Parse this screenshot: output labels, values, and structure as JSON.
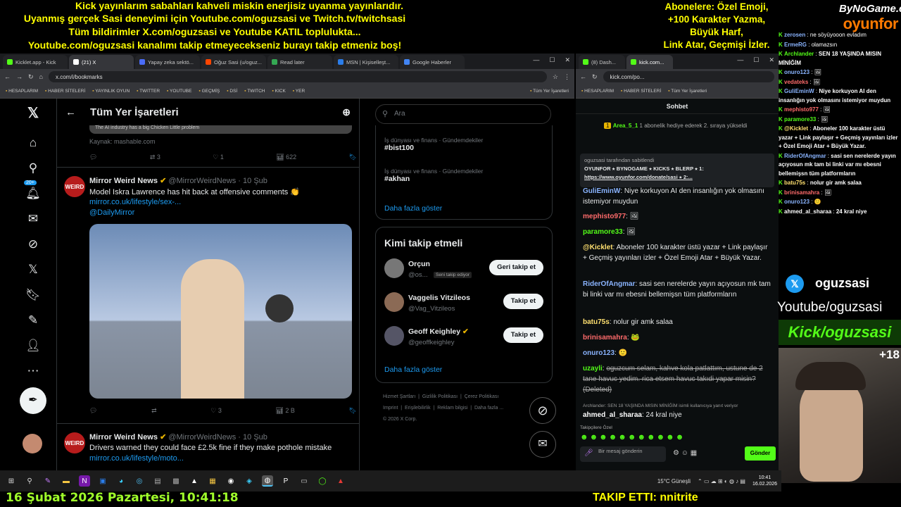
{
  "overlay": {
    "banner_left": [
      "Kick yayınlarım sabahları kahveli miskin enerjisiz uyanma yayınlarıdır.",
      "Uyanmış gerçek Sasi deneyimi için Youtube.com/oguzsasi ve Twitch.tv/twitchsasi",
      "Tüm bildirimler X.com/oguzsasi ve Youtube KATIL topluluktа...",
      "Youtube.com/oguzsasi kanalımı takip etmeyecekseniz burayı takip etmeniz boş!"
    ],
    "banner_right": [
      "Abonelere: Özel Emoji,",
      "+100 Karakter Yazma,",
      "Büyük Harf,",
      "Link Atar, Geçmişi İzler."
    ],
    "logo_top": "ByNoGame.com",
    "logo_bottom": "oyunfor",
    "social_handle": "oguzsasi",
    "youtube_text": "Youtube/oguzsasi",
    "kick_text": "Kick/oguzsasi",
    "age_badge": "+18",
    "datetime": "16 Şubat 2026 Pazartesi, 10:41:18",
    "followed_text": "TAKIP ETTI: nnitrite"
  },
  "browser_left": {
    "tabs": [
      {
        "label": "Kicklet.app - Kick",
        "color": "#53fc18"
      },
      {
        "label": "(21) X",
        "color": "#ffffff"
      },
      {
        "label": "Yapay zeka sektö...",
        "color": "#4a6cf7"
      },
      {
        "label": "Oğuz Sasi (u/oguz...",
        "color": "#ff4500"
      },
      {
        "label": "Read later",
        "color": "#34a853"
      },
      {
        "label": "MSN | Kişiselleşt...",
        "color": "#2b7de9"
      },
      {
        "label": "Google Haberler",
        "color": "#4285f4"
      }
    ],
    "url": "x.com/i/bookmarks",
    "bookmarks": [
      "HESAPLARIM",
      "HABER SİTELERİ",
      "YAYINLIK OYUN",
      "TWITTER",
      "YOUTUBE",
      "GEÇMİŞ",
      "DSİ",
      "TWITCH",
      "KICK",
      "YER",
      "Tüm Yer İşaretleri"
    ]
  },
  "x": {
    "header_title": "Tüm Yer İşaretleri",
    "notif_badge": "20+",
    "prev_tweet": {
      "caption": "The AI industry has a big Chicken Little problem",
      "source": "Kaynak: mashable.com",
      "retweets": "3",
      "likes": "1",
      "views": "622"
    },
    "tweets": [
      {
        "avatar": "WEIRD",
        "name": "Mirror Weird News",
        "handle": "@MirrorWeirdNews · 10 Şub",
        "text": "Model Iskra Lawrence has hit back at offensive comments 👏",
        "link": "mirror.co.uk/lifestyle/sex-...",
        "link2": "@DailyMirror",
        "likes": "3",
        "views": "2 B"
      },
      {
        "avatar": "WEIRD",
        "name": "Mirror Weird News",
        "handle": "@MirrorWeirdNews · 10 Şub",
        "text": "Drivers warned they could face £2.5k fine if they make pothole mistake",
        "link": "mirror.co.uk/lifestyle/moto..."
      }
    ],
    "search_placeholder": "Ara",
    "trends": [
      {
        "sub": "İş dünyası ve finans · Gündemdekiler",
        "title": "#bist100"
      },
      {
        "sub": "İş dünyası ve finans · Gündemdekiler",
        "title": "#akhan"
      }
    ],
    "show_more": "Daha fazla göster",
    "who_title": "Kimi takip etmeli",
    "who": [
      {
        "name": "Orçun",
        "handle": "@os...",
        "tag": "Seni takip ediyor",
        "button": "Geri takip et"
      },
      {
        "name": "Vaggelis Vitzileos",
        "handle": "@Vag_Vitzileos",
        "button": "Takip et"
      },
      {
        "name": "Geoff Keighley",
        "handle": "@geoffkeighley",
        "button": "Takip et"
      }
    ],
    "footer": [
      "Hizmet Şartları",
      "Gizlilik Politikası",
      "Çerez Politikası",
      "Imprint",
      "Erişilebilirlik",
      "Reklam bilgisi",
      "Daha fazla ...",
      "© 2026 X Corp."
    ]
  },
  "browser_right": {
    "tabs": [
      {
        "label": "(8) Dash...",
        "color": "#53fc18"
      },
      {
        "label": "kick.com...",
        "color": "#53fc18"
      }
    ],
    "url": "kick.com/po...",
    "bookmarks": [
      "HESAPLARIM",
      "HABER SİTELERİ",
      "Tüm Yer İşaretleri"
    ],
    "chat_title": "Sohbet",
    "gift_user": "Area_5_1",
    "gift_text": "1 abonelik hediye ederek 2. sıraya yükseldi",
    "pinned_by": "oguzsasi tarafından sabitlendi",
    "pinned_text": "OYUNFOR ⭑ BYNOGAME ⭑ KICKS ⭑ BLERP ⭑ 1:",
    "pinned_link": "https://www.oyunfor.com/donate/sasi ⭑ 2:...",
    "messages": [
      {
        "user": "GuliEminW",
        "cls": "u-blue",
        "text": "Niye korkuyon AI den insanlığın yok olmasını istemiyor muydun"
      },
      {
        "user": "mephisto977",
        "cls": "u-red",
        "text": "🖼"
      },
      {
        "user": "paramore33",
        "cls": "u-green",
        "text": "🖼"
      },
      {
        "user": "@Kicklet",
        "cls": "u-yel",
        "text": "Aboneler 100 karakter üstü yazar + Link paylaşır + Geçmiş yayınları izler + Özel Emoji Atar + Büyük Yazar."
      },
      {
        "user": "RiderOfAngmar",
        "cls": "u-blue",
        "text": "sasi sen nerelerde yayın açıyosun mk tam bi linki var mı ebesni bellemişsn tüm platformların"
      },
      {
        "user": "batu75s",
        "cls": "u-yel",
        "text": "nolur gir amk salaa"
      },
      {
        "user": "brinisamahra",
        "cls": "u-red",
        "text": "🐸"
      },
      {
        "user": "onuro123",
        "cls": "u-blue",
        "text": "🙂"
      },
      {
        "user": "uzayli",
        "cls": "u-green",
        "text": "oguzcum selam, kahve kola patlattım, ustune de 2 tane havuc yedim. rica etsem havuc takıdi yapar misin? (Deleted)"
      },
      {
        "reply": "Archlander: SEN 18 YAŞINDA MISIN MİNİĞİM isimli kullanıcıya yanıt veriyor"
      },
      {
        "user": "ahmed_al_sharaa",
        "cls": "u-wht",
        "text": "24 kral niye"
      }
    ],
    "followers_special": "Takipçilere Özel",
    "send_placeholder": "Bir mesaj gönderin",
    "send_button": "Gönder"
  },
  "sidechat": [
    {
      "user": "zerosen",
      "text": "ne söyüyooon evladım"
    },
    {
      "user": "ErmeRG",
      "text": "olamazsın"
    },
    {
      "user": "Archlander",
      "text": "SEN 18 YAŞINDA MISIN MİNİĞİM"
    },
    {
      "user": "onuro123",
      "text": "🖼"
    },
    {
      "user": "vedateks",
      "text": "🖼"
    },
    {
      "user": "GuliEminW",
      "text": "Niye korkuyon AI den insanlığın yok olmasını istemiyor muydun"
    },
    {
      "user": "mephisto977",
      "text": "🖼"
    },
    {
      "user": "paramore33",
      "text": "🖼"
    },
    {
      "user": "@Kicklet",
      "text": "Aboneler 100 karakter üstü yazar + Link paylaşır + Geçmiş yayınları izler + Özel Emoji Atar + Büyük Yazar."
    },
    {
      "user": "RiderOfAngmar",
      "text": "sasi sen nerelerde yayın açıyosun mk tam bi linki var mı ebesni bellemişsn tüm platformların"
    },
    {
      "user": "batu75s",
      "text": "nolur gir amk salaa"
    },
    {
      "user": "brinisamahra",
      "text": "🖼"
    },
    {
      "user": "onuro123",
      "text": "🙂"
    },
    {
      "user": "ahmed_al_sharaa",
      "text": "24 kral niye"
    }
  ],
  "taskbar": {
    "weather": "15°C  Güneşli",
    "time": "10:41",
    "date": "16.02.2026"
  }
}
